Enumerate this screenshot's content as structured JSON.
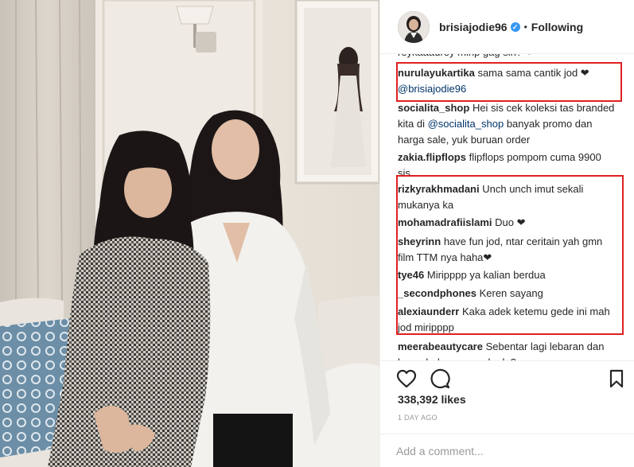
{
  "post": {
    "image_alt": "Two girls posing together in a room"
  },
  "header": {
    "username": "brisiajodie96",
    "verified_mark": "✓",
    "separator": "•",
    "follow_state": "Following"
  },
  "comments": {
    "partial_top": "reykaaaurey mirip gag sih? ❤",
    "items": [
      {
        "user": "nurulayukartika",
        "text": "sama sama cantik jod ❤",
        "mention": "@brisiajodie96",
        "highlighted": true
      },
      {
        "user": "socialita_shop",
        "text": "Hei sis cek koleksi tas branded kita di",
        "mention": "@socialita_shop",
        "text_after": "banyak promo dan harga sale, yuk buruan order",
        "highlighted": false
      },
      {
        "user": "zakia.flipflops",
        "text": "flipflops pompom cuma 9900 sis",
        "highlighted": false
      },
      {
        "user": "rizkyrakhmadani",
        "text": "Unch unch imut sekali mukanya ka",
        "highlighted": true
      },
      {
        "user": "mohamadrafiislami",
        "text": "Duo ❤",
        "highlighted": true
      },
      {
        "user": "sheyrinn",
        "text": "have fun jod, ntar ceritain yah gmn film TTM nya haha❤",
        "highlighted": true
      },
      {
        "user": "tye46",
        "text": "Miripppp ya kalian berdua",
        "highlighted": true
      },
      {
        "user": "_secondphones",
        "text": "Keren sayang",
        "highlighted": true
      },
      {
        "user": "alexiaunderr",
        "text": "Kaka adek ketemu gede ini mah jod miripppp",
        "highlighted": true
      },
      {
        "user": "meerabeautycare",
        "text": "Sebentar lagi lebaran dan kamu belum punya kado?",
        "highlighted": false
      }
    ]
  },
  "actions": {
    "like_icon": "heart-icon",
    "comment_icon": "comment-icon",
    "save_icon": "bookmark-icon"
  },
  "likes": "338,392 likes",
  "timestamp": "1 DAY AGO",
  "add_comment": {
    "placeholder": "Add a comment..."
  },
  "colors": {
    "highlight_border": "#e02020",
    "mention": "#003569",
    "verified": "#3897f0",
    "muted": "#999999"
  }
}
